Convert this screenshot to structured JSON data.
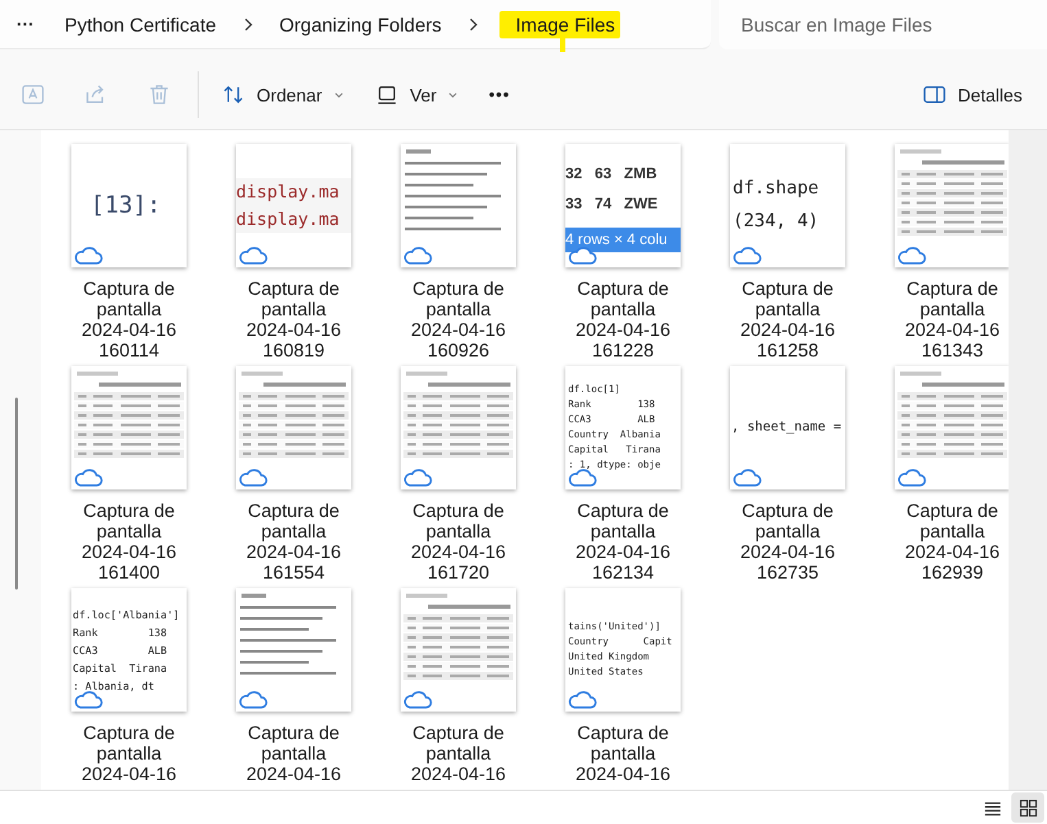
{
  "address": {
    "more": "···",
    "crumbs": [
      {
        "label": "Python Certificate",
        "highlighted": false
      },
      {
        "label": "Organizing Folders",
        "highlighted": false
      },
      {
        "label": "Image Files",
        "highlighted": true
      }
    ]
  },
  "search": {
    "placeholder": "Buscar en Image Files"
  },
  "toolbar": {
    "actions": [
      {
        "kind": "rename",
        "disabled": true
      },
      {
        "kind": "share",
        "disabled": true
      },
      {
        "kind": "delete",
        "disabled": true
      }
    ],
    "sort": "Ordenar",
    "view": "Ver",
    "more": "•••",
    "details": "Detalles"
  },
  "files": [
    {
      "name": "Captura de pantalla 2024-04-16 160114",
      "thumb": {
        "kind": "prompt",
        "lines": [
          "[13]:"
        ]
      }
    },
    {
      "name": "Captura de pantalla 2024-04-16 160819",
      "thumb": {
        "kind": "display",
        "lines": [
          "display.ma",
          "display.ma"
        ]
      }
    },
    {
      "name": "Captura de pantalla 2024-04-16 160926",
      "thumb": {
        "kind": "info"
      }
    },
    {
      "name": "Captura de pantalla 2024-04-16 161228",
      "thumb": {
        "kind": "rows",
        "lines": [
          "32   63   ZMB",
          "33   74   ZWE",
          "4 rows × 4 colu"
        ]
      }
    },
    {
      "name": "Captura de pantalla 2024-04-16 161258",
      "thumb": {
        "kind": "shape",
        "lines": [
          "df.shape",
          "(234, 4)"
        ]
      }
    },
    {
      "name": "Captura de pantalla 2024-04-16 161343",
      "thumb": {
        "kind": "table"
      }
    },
    {
      "name": "Captura de pantalla 2024-04-16 161400",
      "thumb": {
        "kind": "table"
      }
    },
    {
      "name": "Captura de pantalla 2024-04-16 161554",
      "thumb": {
        "kind": "table"
      }
    },
    {
      "name": "Captura de pantalla 2024-04-16 161720",
      "thumb": {
        "kind": "table"
      }
    },
    {
      "name": "Captura de pantalla 2024-04-16 162134",
      "thumb": {
        "kind": "loc",
        "lines": [
          "df.loc[1]",
          "Rank        138",
          "CCA3        ALB",
          "Country  Albania",
          "Capital   Tirana",
          ": 1, dtype: obje"
        ]
      }
    },
    {
      "name": "Captura de pantalla 2024-04-16 162735",
      "thumb": {
        "kind": "sheet",
        "lines": [
          ", sheet_name ="
        ]
      }
    },
    {
      "name": "Captura de pantalla 2024-04-16 162939",
      "thumb": {
        "kind": "table"
      }
    },
    {
      "name": "Captura de pantalla 2024-04-16",
      "thumb": {
        "kind": "label",
        "lines": [
          "df.loc['Albania']",
          "Rank        138",
          "CCA3        ALB",
          "Capital  Tirana",
          ": Albania, dt"
        ]
      }
    },
    {
      "name": "Captura de pantalla 2024-04-16",
      "thumb": {
        "kind": "info"
      }
    },
    {
      "name": "Captura de pantalla 2024-04-16",
      "thumb": {
        "kind": "table"
      }
    },
    {
      "name": "Captura de pantalla 2024-04-16",
      "thumb": {
        "kind": "filter",
        "lines": [
          "tains('United')]",
          "Country      Capit",
          "United Kingdom",
          "United States"
        ]
      }
    }
  ],
  "view_modes": [
    {
      "kind": "list",
      "selected": false
    },
    {
      "kind": "grid",
      "selected": true
    }
  ]
}
